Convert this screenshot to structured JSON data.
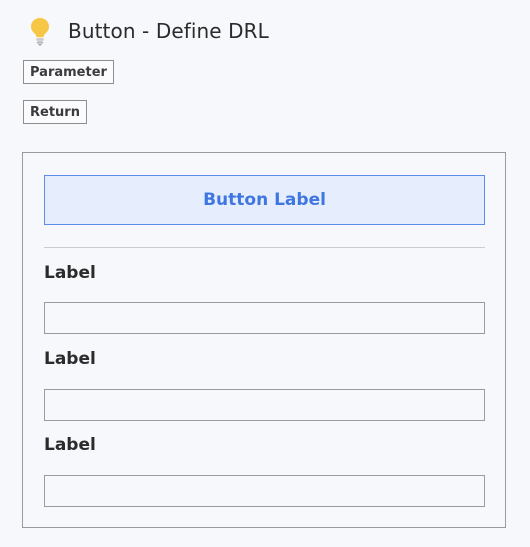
{
  "header": {
    "icon": "lightbulb-icon",
    "title": "Button - Define DRL"
  },
  "tags": {
    "parameter_label": "Parameter",
    "return_label": "Return"
  },
  "panel": {
    "button_label": "Button Label",
    "fields": [
      {
        "label": "Label",
        "value": ""
      },
      {
        "label": "Label",
        "value": ""
      },
      {
        "label": "Label",
        "value": ""
      }
    ]
  },
  "colors": {
    "accent": "#3f76e0",
    "accent_bg": "#e6eefe",
    "bulb": "#f6c645",
    "background": "#f7f8fc"
  }
}
